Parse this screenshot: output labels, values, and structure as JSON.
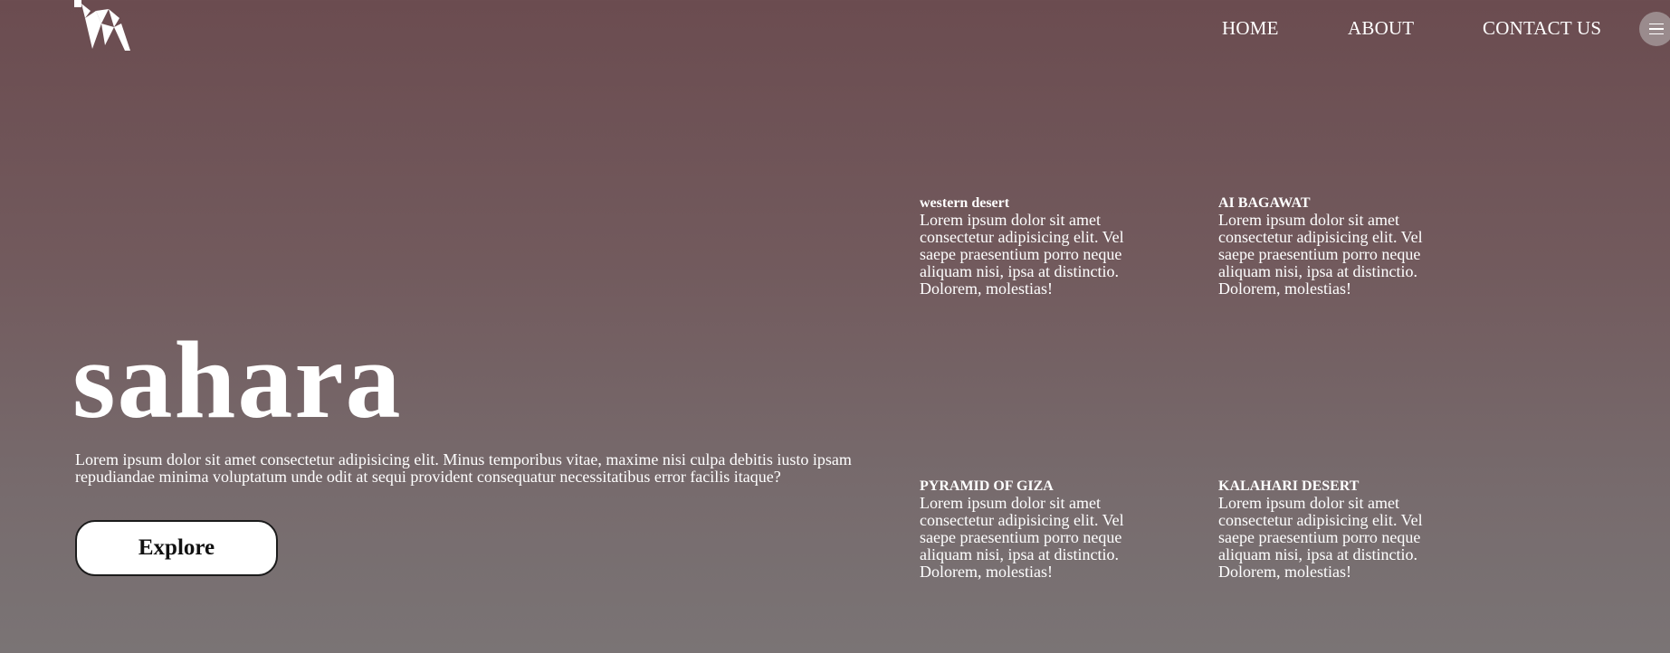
{
  "header": {
    "logo_icon": "origami-camel-logo-icon",
    "nav": [
      {
        "label": "HOME"
      },
      {
        "label": "ABOUT"
      },
      {
        "label": "CONTACT US"
      }
    ],
    "menu_icon": "hamburger-menu-icon"
  },
  "hero": {
    "title": "sahara",
    "description": "Lorem ipsum dolor sit amet consectetur adipisicing elit. Minus temporibus vitae, maxime nisi culpa debitis iusto ipsam repudiandae minima voluptatum unde odit at sequi provident consequatur necessitatibus error facilis itaque?",
    "explore_label": "Explore"
  },
  "places": [
    {
      "title": "western desert",
      "text": "Lorem ipsum dolor sit amet consectetur adipisicing elit. Vel saepe praesentium porro neque aliquam nisi, ipsa at distinctio. Dolorem, molestias!"
    },
    {
      "title": "AI BAGAWAT",
      "text": "Lorem ipsum dolor sit amet consectetur adipisicing elit. Vel saepe praesentium porro neque aliquam nisi, ipsa at distinctio. Dolorem, molestias!"
    },
    {
      "title": "PYRAMID OF GIZA",
      "text": "Lorem ipsum dolor sit amet consectetur adipisicing elit. Vel saepe praesentium porro neque aliquam nisi, ipsa at distinctio. Dolorem, molestias!"
    },
    {
      "title": "KALAHARI DESERT",
      "text": "Lorem ipsum dolor sit amet consectetur adipisicing elit. Vel saepe praesentium porro neque aliquam nisi, ipsa at distinctio. Dolorem, molestias!"
    }
  ],
  "colors": {
    "background_top": "#6b4c50",
    "background_bottom": "#7a7475",
    "text": "#ffffff",
    "button_bg": "#ffffff",
    "button_text": "#111111",
    "menu_button_bg": "#9a8b8d"
  }
}
